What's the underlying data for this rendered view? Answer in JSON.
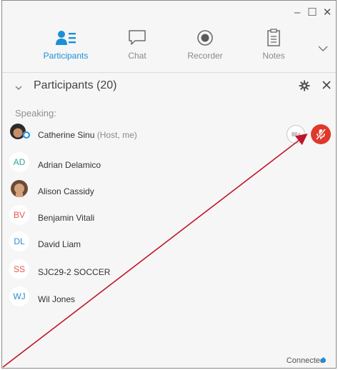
{
  "window": {
    "minimize_glyph": "–",
    "maximize_glyph": "☐",
    "close_glyph": "✕"
  },
  "tabs": [
    {
      "label": "Participants",
      "icon": "participants-icon",
      "active": true
    },
    {
      "label": "Chat",
      "icon": "chat-icon",
      "active": false
    },
    {
      "label": "Recorder",
      "icon": "record-icon",
      "active": false
    },
    {
      "label": "Notes",
      "icon": "notes-icon",
      "active": false
    }
  ],
  "panel": {
    "title": "Participants (20)",
    "speaking_label": "Speaking:"
  },
  "participants": [
    {
      "name": "Catherine Sinu",
      "role": "(Host, me)",
      "initials": "",
      "color": "#3a3a3a",
      "muted": true
    },
    {
      "name": "Adrian Delamico",
      "role": "",
      "initials": "AD",
      "color": "#27a7a0"
    },
    {
      "name": "Alison Cassidy",
      "role": "",
      "initials": "",
      "color": "#b57a55"
    },
    {
      "name": "Benjamin Vitali",
      "role": "",
      "initials": "BV",
      "color": "#e4574b"
    },
    {
      "name": "David Liam",
      "role": "",
      "initials": "DL",
      "color": "#2b8fd6"
    },
    {
      "name": "SJC29-2 SOCCER",
      "role": "",
      "initials": "SS",
      "color": "#e4574b"
    },
    {
      "name": "Wil Jones",
      "role": "",
      "initials": "WJ",
      "color": "#2b8fd6"
    }
  ],
  "status": {
    "text": "Connected",
    "color": "#1d8fd8"
  },
  "colors": {
    "accent": "#1d8fd8",
    "mute_red": "#e0392b",
    "annotation_arrow": "#c0152a"
  }
}
